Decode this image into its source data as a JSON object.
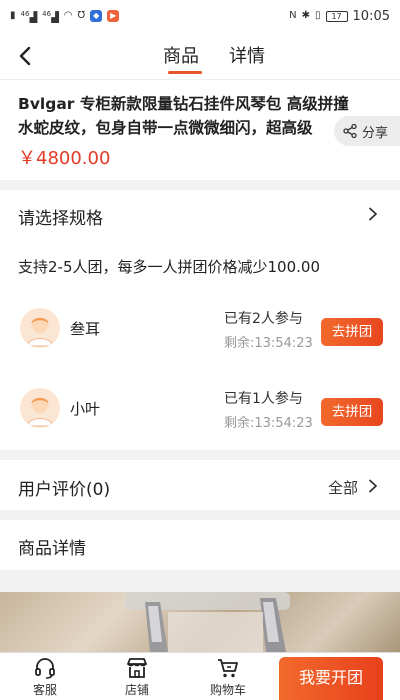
{
  "status_bar": {
    "left_indicators": [
      "46",
      "46"
    ],
    "battery": "17",
    "time": "10:05"
  },
  "header": {
    "tabs": [
      {
        "label": "商品",
        "active": true
      },
      {
        "label": "详情",
        "active": false
      }
    ]
  },
  "product": {
    "title": "Bvlgar 专柜新款限量钻石挂件风琴包 高级拼撞水蛇皮纹，包身自带一点微微细闪，超高级",
    "price": "￥4800.00",
    "share_label": "分享"
  },
  "spec": {
    "title": "请选择规格",
    "support_text": "支持2-5人团，每多一人拼团价格减少100.00"
  },
  "groups": [
    {
      "name": "叁耳",
      "joined": "已有2人参与",
      "remain": "剩余:13:54:23",
      "button": "去拼团"
    },
    {
      "name": "小叶",
      "joined": "已有1人参与",
      "remain": "剩余:13:54:23",
      "button": "去拼团"
    }
  ],
  "review": {
    "title": "用户评价(0)",
    "all_label": "全部"
  },
  "detail": {
    "title": "商品详情"
  },
  "bottom_bar": {
    "items": [
      {
        "label": "客服",
        "icon": "headset-icon"
      },
      {
        "label": "店铺",
        "icon": "store-icon"
      },
      {
        "label": "购物车",
        "icon": "cart-icon"
      }
    ],
    "primary_button": "我要开团"
  },
  "colors": {
    "accent": "#e8542b",
    "price": "#e33b26"
  }
}
